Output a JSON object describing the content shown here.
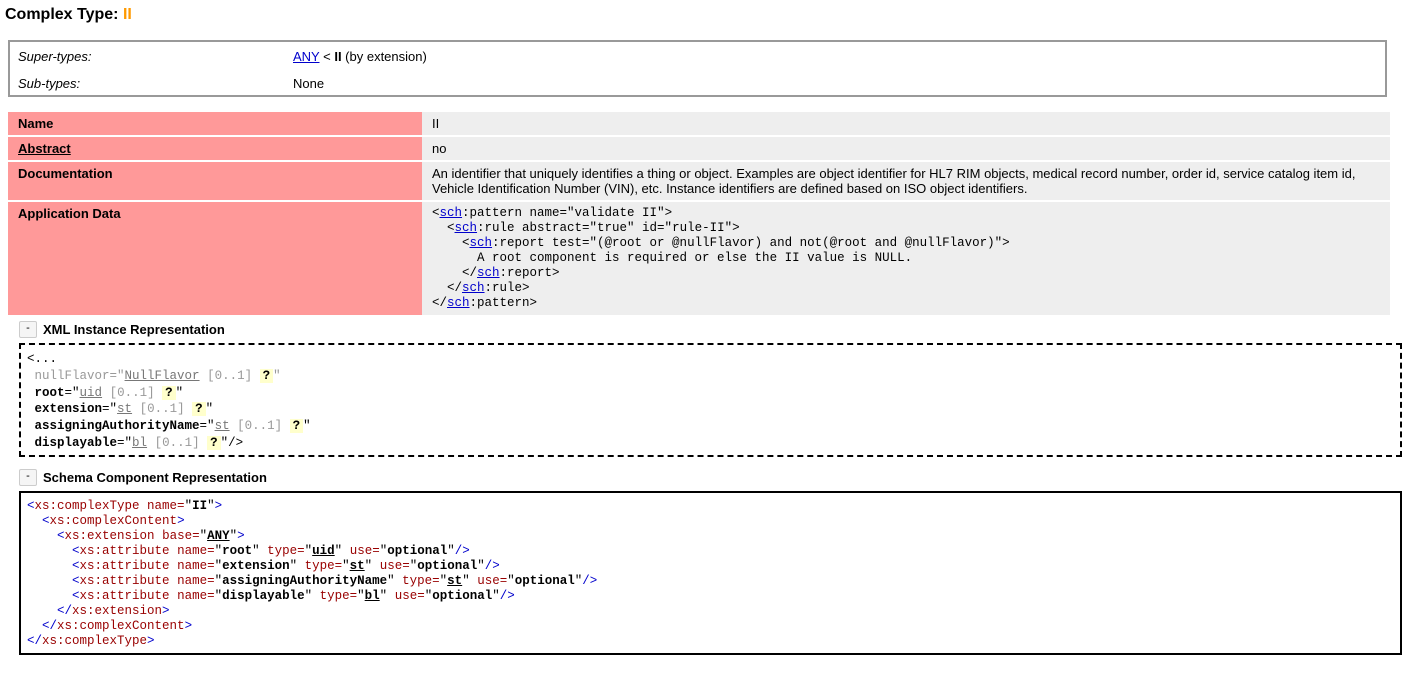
{
  "page": {
    "title_prefix": "Complex Type: ",
    "title_name": "II"
  },
  "hierarchy": {
    "super_label": "Super-types:",
    "super_link": "ANY",
    "super_rest_sep": " < ",
    "super_name": "II",
    "super_suffix": " (by extension)",
    "sub_label": "Sub-types:",
    "sub_value": "None"
  },
  "props": {
    "name_label": "Name",
    "name_value": "II",
    "abstract_label": "Abstract",
    "abstract_value": "no",
    "doc_label": "Documentation",
    "doc_value": "An identifier that uniquely identifies a thing or object. Examples are object identifier for HL7 RIM objects, medical record number, order id, service catalog item id, Vehicle Identification Number (VIN), etc. Instance identifiers are defined based on ISO object identifiers.",
    "app_label": "Application Data",
    "app_prefix": "sch",
    "app_lines": [
      ":pattern name=\"validate II\">",
      ":rule abstract=\"true\" id=\"rule-II\">",
      ":report test=\"(@root or @nullFlavor) and not(@root and @nullFlavor)\">",
      "A root component is required or else the II value is NULL.",
      ":report>",
      ":rule>",
      ":pattern>"
    ]
  },
  "xml_section": {
    "toggle": "-",
    "title": "XML Instance Representation",
    "open": "<...",
    "attrs": [
      {
        "name": "nullFlavor",
        "type": "NullFlavor",
        "occ": "[0..1]",
        "grayed": true
      },
      {
        "name": "root",
        "type": "uid",
        "occ": "[0..1]",
        "grayed": false
      },
      {
        "name": "extension",
        "type": "st",
        "occ": "[0..1]",
        "grayed": false
      },
      {
        "name": "assigningAuthorityName",
        "type": "st",
        "occ": "[0..1]",
        "grayed": false
      },
      {
        "name": "displayable",
        "type": "bl",
        "occ": "[0..1]",
        "grayed": false
      }
    ],
    "q": "?",
    "close": "/>"
  },
  "schema_section": {
    "toggle": "-",
    "title": "Schema Component Representation",
    "complex_type_name": "II",
    "base": "ANY",
    "attributes": [
      {
        "name": "root",
        "type": "uid",
        "use": "optional"
      },
      {
        "name": "extension",
        "type": "st",
        "use": "optional"
      },
      {
        "name": "assigningAuthorityName",
        "type": "st",
        "use": "optional"
      },
      {
        "name": "displayable",
        "type": "bl",
        "use": "optional"
      }
    ]
  },
  "colors": {
    "accent": "#ff9900",
    "key_cell": "#ff9999",
    "value_cell": "#eeeeee",
    "link": "#0000cc",
    "tag": "#990000"
  }
}
